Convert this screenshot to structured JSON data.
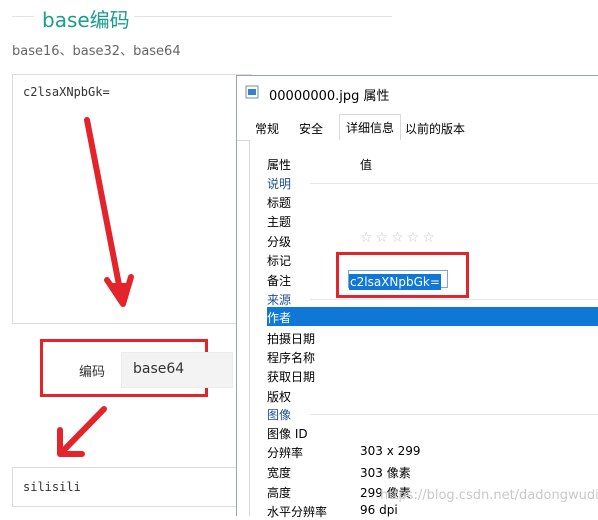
{
  "page": {
    "section_title": "base编码",
    "subtitle": "base16、base32、base64",
    "input_text": "c2lsaXNpbGk=",
    "encode_label": "编码",
    "encode_value": "base64",
    "output_text": "silisili",
    "accent_color": "#1a9c8e",
    "annotation_color": "#e3242b"
  },
  "dialog": {
    "title": "00000000.jpg 属性",
    "tabs": [
      "常规",
      "安全",
      "详细信息",
      "以前的版本"
    ],
    "active_tab": "详细信息",
    "col_property": "属性",
    "col_value": "值",
    "groups": {
      "description": "说明",
      "origin": "来源",
      "image": "图像"
    },
    "rows": {
      "title": "标题",
      "subject": "主题",
      "rating": "分级",
      "tags": "标记",
      "comments": "备注",
      "comments_value": "c2lsaXNpbGk=",
      "author": "作者",
      "date_taken": "拍摄日期",
      "program_name": "程序名称",
      "date_acquired": "获取日期",
      "copyright": "版权",
      "image_id": "图像 ID",
      "dimensions": "分辨率",
      "dimensions_value": "303 x 299",
      "width": "宽度",
      "width_value": "303 像素",
      "height": "高度",
      "height_value": "299 像素",
      "hres": "水平分辨率",
      "hres_value": "96 dpi"
    },
    "rating_stars": "☆☆☆☆☆"
  },
  "watermark": "https://blog.csdn.net/dadongwudi"
}
